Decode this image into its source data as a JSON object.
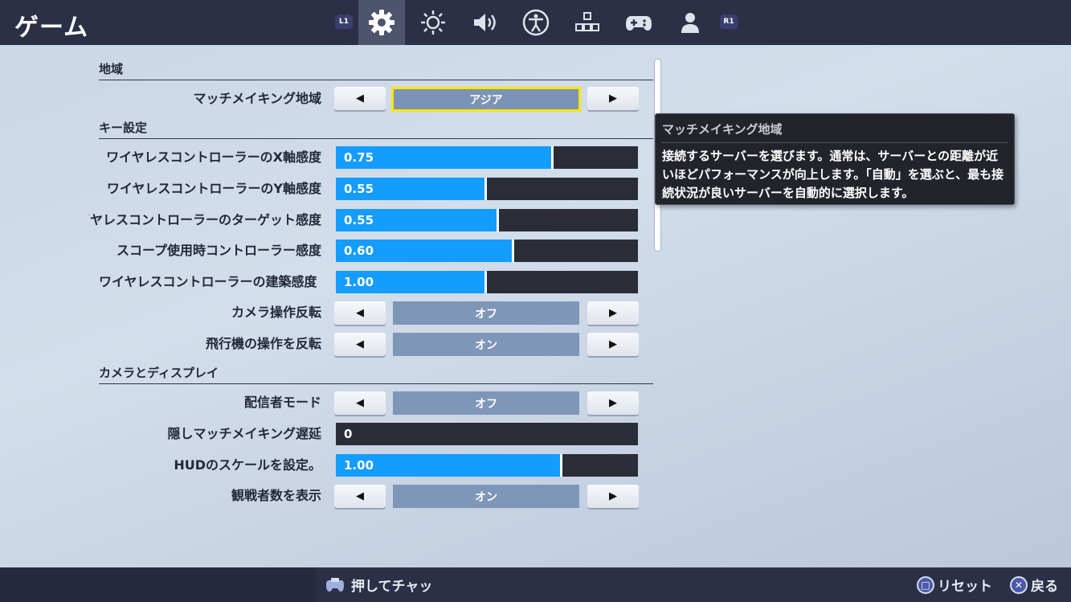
{
  "header": {
    "title": "ゲーム",
    "left_shoulder": "L1",
    "right_shoulder": "R1",
    "tabs": [
      {
        "icon": "gear-icon",
        "active": true
      },
      {
        "icon": "brightness-icon",
        "active": false
      },
      {
        "icon": "speaker-icon",
        "active": false
      },
      {
        "icon": "accessibility-icon",
        "active": false
      },
      {
        "icon": "input-layout-icon",
        "active": false
      },
      {
        "icon": "gamepad-icon",
        "active": false
      },
      {
        "icon": "account-icon",
        "active": false
      }
    ]
  },
  "sections": {
    "region": {
      "header": "地域",
      "matchmaking_region": {
        "label": "マッチメイキング地域",
        "value": "アジア",
        "selected": true
      }
    },
    "controls": {
      "header": "キー設定",
      "x_sensitivity": {
        "label": "ワイヤレスコントローラーのX軸感度",
        "value": "0.75",
        "fill": 0.72
      },
      "y_sensitivity": {
        "label": "ワイヤレスコントローラーのY軸感度",
        "value": "0.55",
        "fill": 0.5
      },
      "targeting_sensitivity": {
        "label": "ワイヤレスコントローラーのターゲット感度",
        "value": "0.55",
        "fill": 0.54
      },
      "scope_sensitivity": {
        "label": "スコープ使用時コントローラー感度",
        "value": "0.60",
        "fill": 0.59
      },
      "building_sensitivity": {
        "label": "ワイヤレスコントローラーの建築感度",
        "value": "1.00",
        "fill": 0.5
      },
      "invert_camera": {
        "label": "カメラ操作反転",
        "value": "オフ"
      },
      "invert_aircraft": {
        "label": "飛行機の操作を反転",
        "value": "オン"
      }
    },
    "camera_display": {
      "header": "カメラとディスプレイ",
      "streamer_mode": {
        "label": "配信者モード",
        "value": "オフ"
      },
      "hidden_matchmaking_delay": {
        "label": "隠しマッチメイキング遅延",
        "value": "0",
        "fill": 0.0
      },
      "hud_scale": {
        "label": "HUDのスケールを設定。",
        "value": "1.00",
        "fill": 0.75
      },
      "show_spectator_count": {
        "label": "観戦者数を表示",
        "value": "オン"
      }
    }
  },
  "arrows": {
    "left": "◀",
    "right": "▶"
  },
  "tooltip": {
    "title": "マッチメイキング地域",
    "body": "接続するサーバーを選びます。通常は、サーバーとの距離が近いほどパフォーマンスが向上します。「自動」を選ぶと、最も接続状況が良いサーバーを自動的に選択します。"
  },
  "footer": {
    "chat_hint": "押してチャッ",
    "reset_label": "リセット",
    "back_label": "戻る",
    "reset_glyph": "□",
    "back_glyph": "✕"
  },
  "colors": {
    "bar_bg": "#2b3046",
    "slider_fill": "#149cff",
    "slider_track": "#2a2d37",
    "value_box": "#7e96b8",
    "selection_outline": "#ffe600"
  }
}
